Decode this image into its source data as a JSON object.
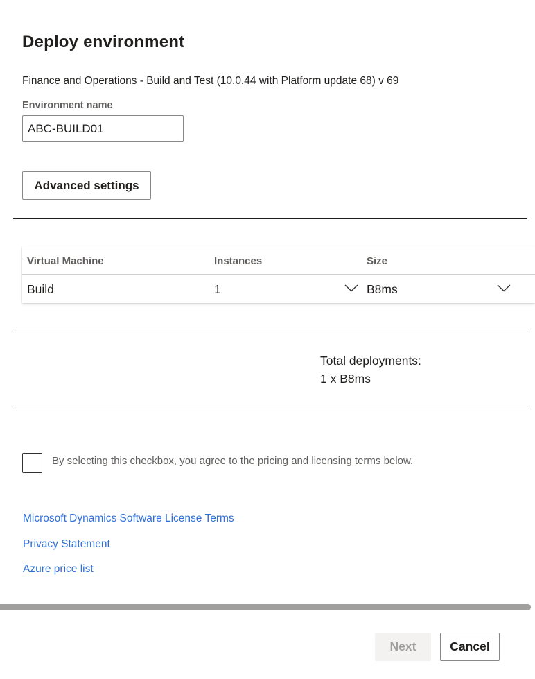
{
  "dialog": {
    "title": "Deploy environment",
    "subtitle": "Finance and Operations - Build and Test (10.0.44 with Platform update 68) v 69"
  },
  "environment_name": {
    "label": "Environment name",
    "value": "ABC-BUILD01"
  },
  "advanced_settings_label": "Advanced settings",
  "vm_table": {
    "headers": [
      "Virtual Machine",
      "Instances",
      "Size"
    ],
    "rows": [
      {
        "virtual_machine": "Build",
        "instances": "1",
        "size": "B8ms"
      }
    ]
  },
  "totals": {
    "label": "Total deployments:",
    "value": "1 x B8ms"
  },
  "agreement": {
    "checked": false,
    "text": "By selecting this checkbox, you agree to the pricing and licensing terms below."
  },
  "links": [
    "Microsoft Dynamics Software License Terms",
    "Privacy Statement",
    "Azure price list"
  ],
  "footer": {
    "next_label": "Next",
    "next_enabled": false,
    "cancel_label": "Cancel"
  },
  "colors": {
    "link": "#2f6fd8",
    "text": "#201f1e",
    "muted": "#605e5c",
    "disabled_bg": "#f3f2f1"
  },
  "icons": {
    "instances_dropdown": "chevron-down-icon",
    "size_dropdown": "chevron-down-icon"
  }
}
